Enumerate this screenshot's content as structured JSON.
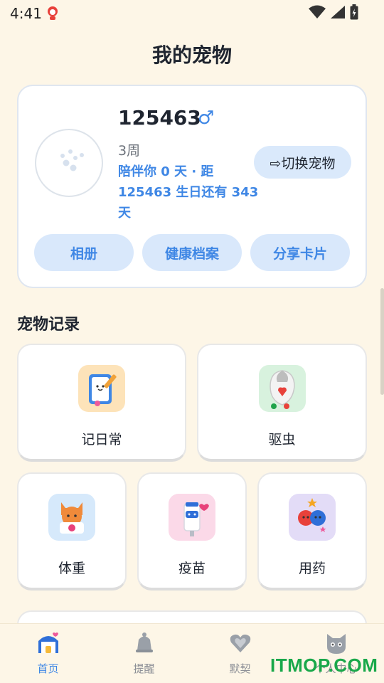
{
  "status_bar": {
    "time": "4:41",
    "icons": [
      "app-notification-icon",
      "wifi-icon",
      "signal-icon",
      "battery-icon"
    ]
  },
  "header": {
    "title": "我的宠物"
  },
  "pet": {
    "name": "125463",
    "gender_symbol": "♂",
    "age": "3周",
    "companion_info": "陪伴你 0 天 · 距 125463 生日还有 343 天",
    "switch_label": "⇨切换宠物",
    "buttons": [
      "相册",
      "健康档案",
      "分享卡片"
    ]
  },
  "records": {
    "section_title": "宠物记录",
    "items": [
      {
        "label": "记日常",
        "icon": "diary-icon",
        "color": "#fde3b9"
      },
      {
        "label": "驱虫",
        "icon": "deworm-icon",
        "color": "#d8f2de"
      },
      {
        "label": "体重",
        "icon": "weight-icon",
        "color": "#d6e9fb"
      },
      {
        "label": "疫苗",
        "icon": "vaccine-icon",
        "color": "#fbd9e8"
      },
      {
        "label": "用药",
        "icon": "medicine-icon",
        "color": "#e3dcf7"
      }
    ]
  },
  "bottom_nav": {
    "items": [
      {
        "label": "首页",
        "icon": "home-icon",
        "active": true
      },
      {
        "label": "提醒",
        "icon": "bell-icon",
        "active": false
      },
      {
        "label": "默契",
        "icon": "heart-icon",
        "active": false
      },
      {
        "label": "个人中心",
        "icon": "cat-icon",
        "active": false
      }
    ]
  },
  "watermark": "ITMOP.COM",
  "colors": {
    "accent": "#3f87e5",
    "background": "#fdf6e7",
    "watermark": "#19a84a"
  }
}
